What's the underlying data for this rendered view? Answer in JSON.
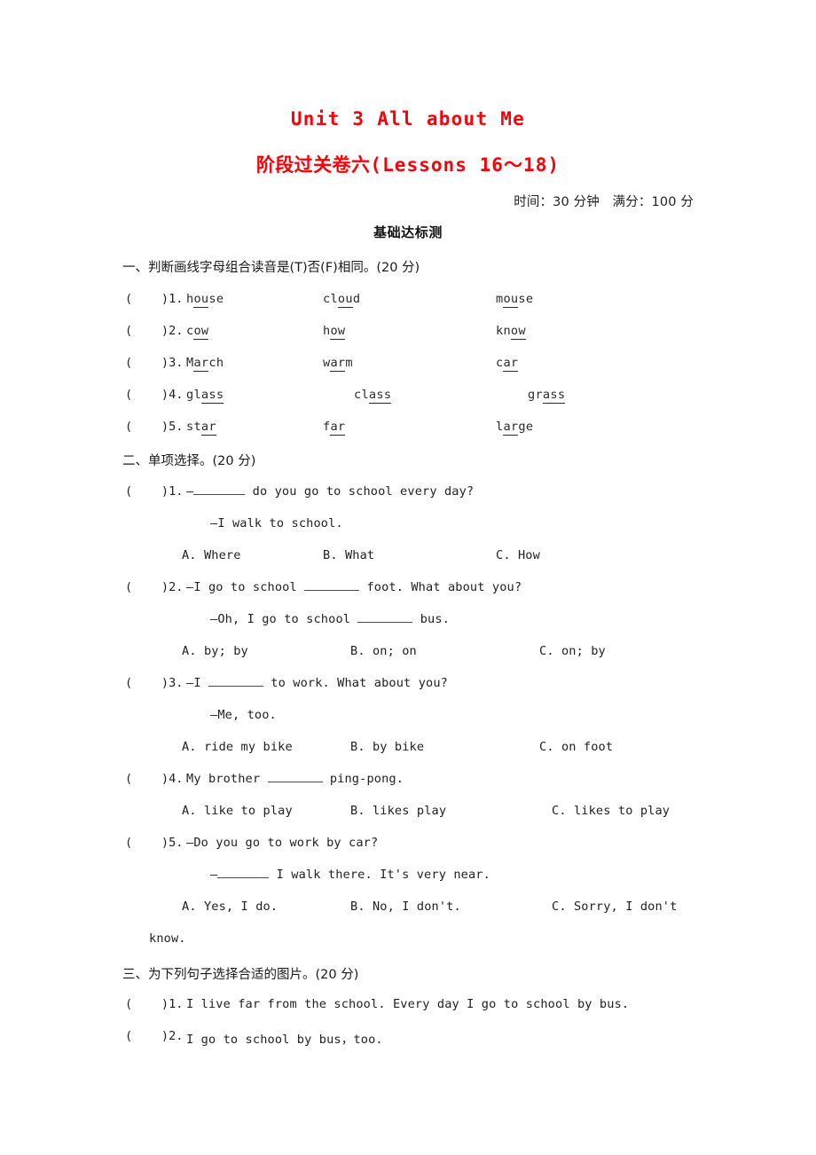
{
  "title": {
    "english": "Unit 3 All about Me",
    "chinese_prefix": "阶段过关卷六",
    "chinese_lessons": "(Lessons 16～18)",
    "color": "#fb0007"
  },
  "meta": {
    "time_and_score": "时间：30 分钟　满分：100 分"
  },
  "part_heading": "基础达标测",
  "sections": [
    {
      "heading": "一、判断画线字母组合读音是(T)否(F)相同。(20 分)",
      "items": [
        {
          "marker": "(    )1.",
          "words": [
            {
              "pre": "h",
              "mid": "ou",
              "post": "se"
            },
            {
              "pre": "cl",
              "mid": "ou",
              "post": "d"
            },
            {
              "pre": "m",
              "mid": "ou",
              "post": "se"
            }
          ]
        },
        {
          "marker": "(    )2.",
          "words": [
            {
              "pre": "c",
              "mid": "ow",
              "post": ""
            },
            {
              "pre": "h",
              "mid": "ow",
              "post": ""
            },
            {
              "pre": "kn",
              "mid": "ow",
              "post": ""
            }
          ]
        },
        {
          "marker": "(    )3.",
          "words": [
            {
              "pre": "M",
              "mid": "ar",
              "post": "ch"
            },
            {
              "pre": "w",
              "mid": "ar",
              "post": "m"
            },
            {
              "pre": "c",
              "mid": "ar",
              "post": ""
            }
          ]
        },
        {
          "marker": "(    )4.",
          "words": [
            {
              "pre": "gl",
              "mid": "ass",
              "post": ""
            },
            {
              "pre": "cl",
              "mid": "ass",
              "post": ""
            },
            {
              "pre": "gr",
              "mid": "ass",
              "post": ""
            }
          ]
        },
        {
          "marker": "(    )5.",
          "words": [
            {
              "pre": "st",
              "mid": "ar",
              "post": ""
            },
            {
              "pre": "f",
              "mid": "ar",
              "post": ""
            },
            {
              "pre": "l",
              "mid": "ar",
              "post": "ge"
            }
          ]
        }
      ]
    },
    {
      "heading": "二、单项选择。(20 分)",
      "questions": [
        {
          "marker": "(    )1.",
          "stem_before": "—",
          "stem_after": " do you go to school every day?",
          "reply": "—I walk to school.",
          "options": [
            "A. Where",
            "B. What",
            "C. How"
          ]
        },
        {
          "marker": "(    )2.",
          "stem_before": "—I go to school ",
          "stem_after": " foot. What about you?",
          "reply_before": "—Oh, I go to school ",
          "reply_after": " bus.",
          "options": [
            "A. by; by",
            "B. on; on",
            "C. on; by"
          ]
        },
        {
          "marker": "(    )3.",
          "stem_before": "—I ",
          "stem_after": " to work. What about you?",
          "reply": "—Me, too.",
          "options": [
            "A. ride my bike",
            "B. by bike",
            "C. on foot"
          ]
        },
        {
          "marker": "(    )4.",
          "stem_before": "My brother ",
          "stem_after": " ping-pong.",
          "options": [
            "A. like to play",
            "B. likes play",
            "C. likes to play"
          ]
        },
        {
          "marker": "(    )5.",
          "stem": "—Do you go to work by car?",
          "reply_before": "—",
          "reply_after": " I walk there. It's very near.",
          "options": [
            "A. Yes, I do.",
            "B. No, I don't.",
            "C. Sorry, I don't"
          ],
          "option_c_overflow": "know."
        }
      ]
    },
    {
      "heading": "三、为下列句子选择合适的图片。(20 分)",
      "items": [
        {
          "marker": "(    )1.",
          "text": "I live far from the school. Every day I go to school by bus."
        },
        {
          "marker": "(    )2.",
          "text": "I go to school by bus，too."
        }
      ]
    }
  ]
}
